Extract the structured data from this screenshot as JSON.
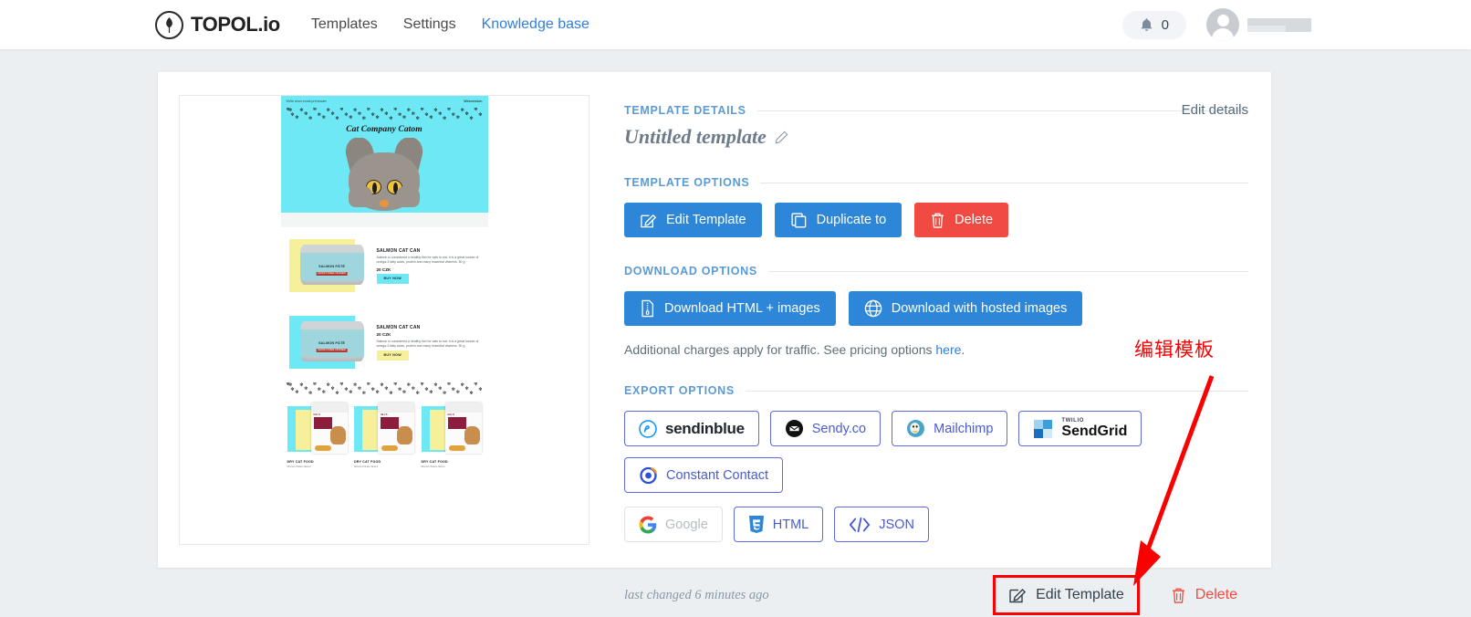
{
  "header": {
    "brand_name": "TOPOL.io",
    "brand_icon": "topol-leaf-logo-icon",
    "nav": [
      {
        "label": "Templates",
        "active": false
      },
      {
        "label": "Settings",
        "active": false
      },
      {
        "label": "Knowledge base",
        "active": true
      }
    ],
    "notification_icon": "bell-icon",
    "notification_count": "0",
    "avatar_icon": "user-avatar-icon",
    "username": ""
  },
  "details": {
    "section_template_details": "TEMPLATE DETAILS",
    "edit_details_label": "Edit details",
    "template_name": "Untitled template",
    "name_edit_icon": "pencil-icon",
    "section_template_options": "TEMPLATE OPTIONS",
    "template_option_buttons": [
      {
        "label": "Edit Template",
        "icon": "pencil-square-icon",
        "style": "blue"
      },
      {
        "label": "Duplicate to",
        "icon": "copy-icon",
        "style": "blue"
      },
      {
        "label": "Delete",
        "icon": "trash-icon",
        "style": "red"
      }
    ],
    "section_download_options": "DOWNLOAD OPTIONS",
    "download_buttons": [
      {
        "label": "Download HTML + images",
        "icon": "zip-file-icon"
      },
      {
        "label": "Download with hosted images",
        "icon": "globe-icon"
      }
    ],
    "hint_text": "Additional charges apply for traffic. See pricing options ",
    "hint_link": "here",
    "hint_tail": ".",
    "section_export_options": "EXPORT OPTIONS",
    "export_buttons": [
      {
        "label": "sendinblue",
        "icon": "sendinblue-icon",
        "disabled": false
      },
      {
        "label": "Sendy.co",
        "icon": "sendy-icon",
        "disabled": false
      },
      {
        "label": "Mailchimp",
        "icon": "mailchimp-icon",
        "disabled": false
      },
      {
        "label": "SendGrid",
        "sublabel": "TWILIO",
        "icon": "sendgrid-icon",
        "disabled": false
      },
      {
        "label": "Constant Contact",
        "icon": "constant-contact-icon",
        "disabled": false
      },
      {
        "label": "Google",
        "icon": "google-icon",
        "disabled": true
      },
      {
        "label": "HTML",
        "icon": "html5-icon",
        "disabled": false
      },
      {
        "label": "JSON",
        "icon": "code-brackets-icon",
        "disabled": false
      }
    ],
    "last_changed": "last changed 6 minutes ago",
    "footer_actions": [
      {
        "label": "Edit Template",
        "icon": "pencil-square-icon",
        "danger": false
      },
      {
        "label": "Delete",
        "icon": "trash-icon",
        "danger": true
      }
    ]
  },
  "annotation": {
    "text": "编辑模板",
    "color": "#fa0000"
  },
  "email_preview": {
    "preheader": "Write short email preheader",
    "webversion": "Webversion",
    "title": "Cat Company Catom",
    "products": [
      {
        "name": "SALMON CAT CAN",
        "desc": "Salmon is considered a healthy fish for cats to eat. It is a great source of omega-3 fatty acids, protein and many essential vitamins. 50 g",
        "price": "20 CZK",
        "button": "BUY NOW",
        "bg": "yellow",
        "button_color": "cyan",
        "can_label": "SALMON PÂTÉ",
        "can_label2": "GRAIN FREE DINNER"
      },
      {
        "name": "SALMON CAT CAN",
        "desc": "Salmon is considered a healthy fish for cats to eat. It is a great source of omega-3 fatty acids, protein and many essential vitamins. 50 g",
        "price": "20 CZK",
        "button": "BUY NOW",
        "bg": "cyan",
        "button_color": "yellow",
        "can_label": "SALMON PÂTÉ",
        "can_label2": "GRAIN FREE DINNER"
      }
    ],
    "dry_items": [
      {
        "caption": "DRY CAT FOOD",
        "sub": "Minced chicken flavour"
      },
      {
        "caption": "DRY CAT FOOD",
        "sub": "Minced chicken flavour"
      },
      {
        "caption": "DRY CAT FOOD",
        "sub": "Minced chicken flavour"
      }
    ]
  },
  "colors": {
    "page_bg": "#eceff1",
    "accent_blue": "#2e86d8",
    "section_blue": "#5b9bd5",
    "danger_red": "#f04a42",
    "annotation_red": "#fa0000",
    "export_border": "#5f6ae0",
    "mail_cyan": "#6fe8f5",
    "mail_yellow": "#f7f09a"
  }
}
